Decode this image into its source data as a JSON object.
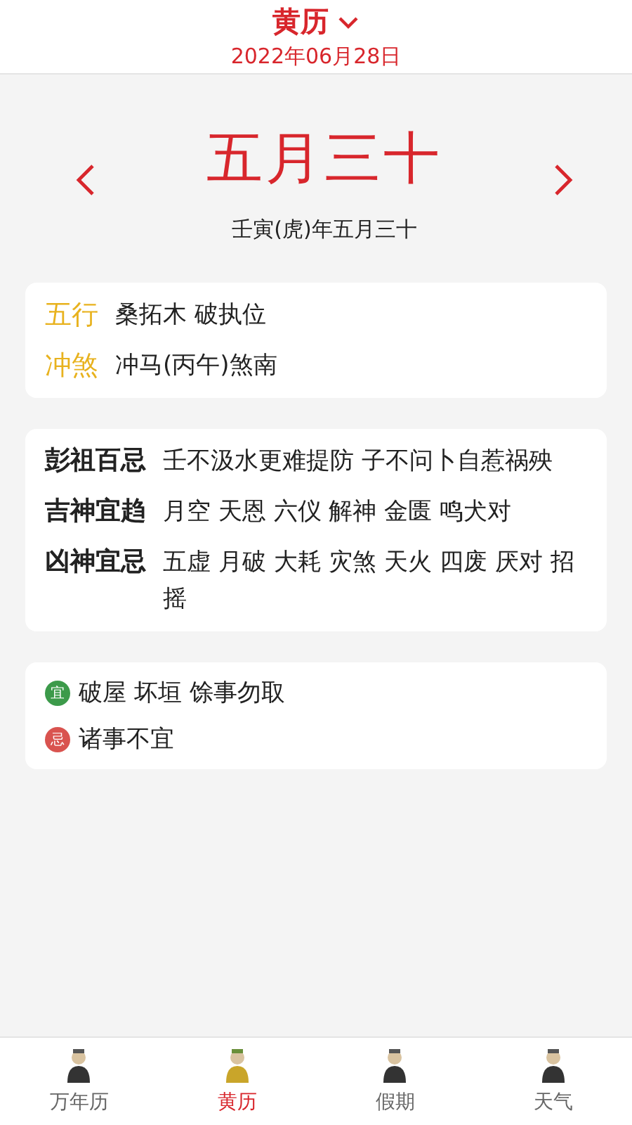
{
  "header": {
    "title": "黄历",
    "date": "2022年06月28日"
  },
  "lunar": {
    "day": "五月三十",
    "ganzhi": "壬寅(虎)年五月三十"
  },
  "wuxing": [
    {
      "label": "五行",
      "value": "桑拓木 破执位"
    },
    {
      "label": "冲煞",
      "value": "冲马(丙午)煞南"
    }
  ],
  "details": [
    {
      "label": "彭祖百忌",
      "value": "壬不汲水更难提防 子不问卜自惹祸殃"
    },
    {
      "label": "吉神宜趋",
      "value": "月空 天恩 六仪 解神 金匮 鸣犬对"
    },
    {
      "label": "凶神宜忌",
      "value": "五虚 月破 大耗 灾煞 天火 四废 厌对 招摇"
    }
  ],
  "yiji": [
    {
      "badge": "宜",
      "color": "#3c9a4a",
      "text": "破屋 坏垣 馀事勿取"
    },
    {
      "badge": "忌",
      "color": "#d9534f",
      "text": "诸事不宜"
    }
  ],
  "tabs": [
    {
      "label": "万年历",
      "selected": false
    },
    {
      "label": "黄历",
      "selected": true
    },
    {
      "label": "假期",
      "selected": false
    },
    {
      "label": "天气",
      "selected": false
    }
  ]
}
